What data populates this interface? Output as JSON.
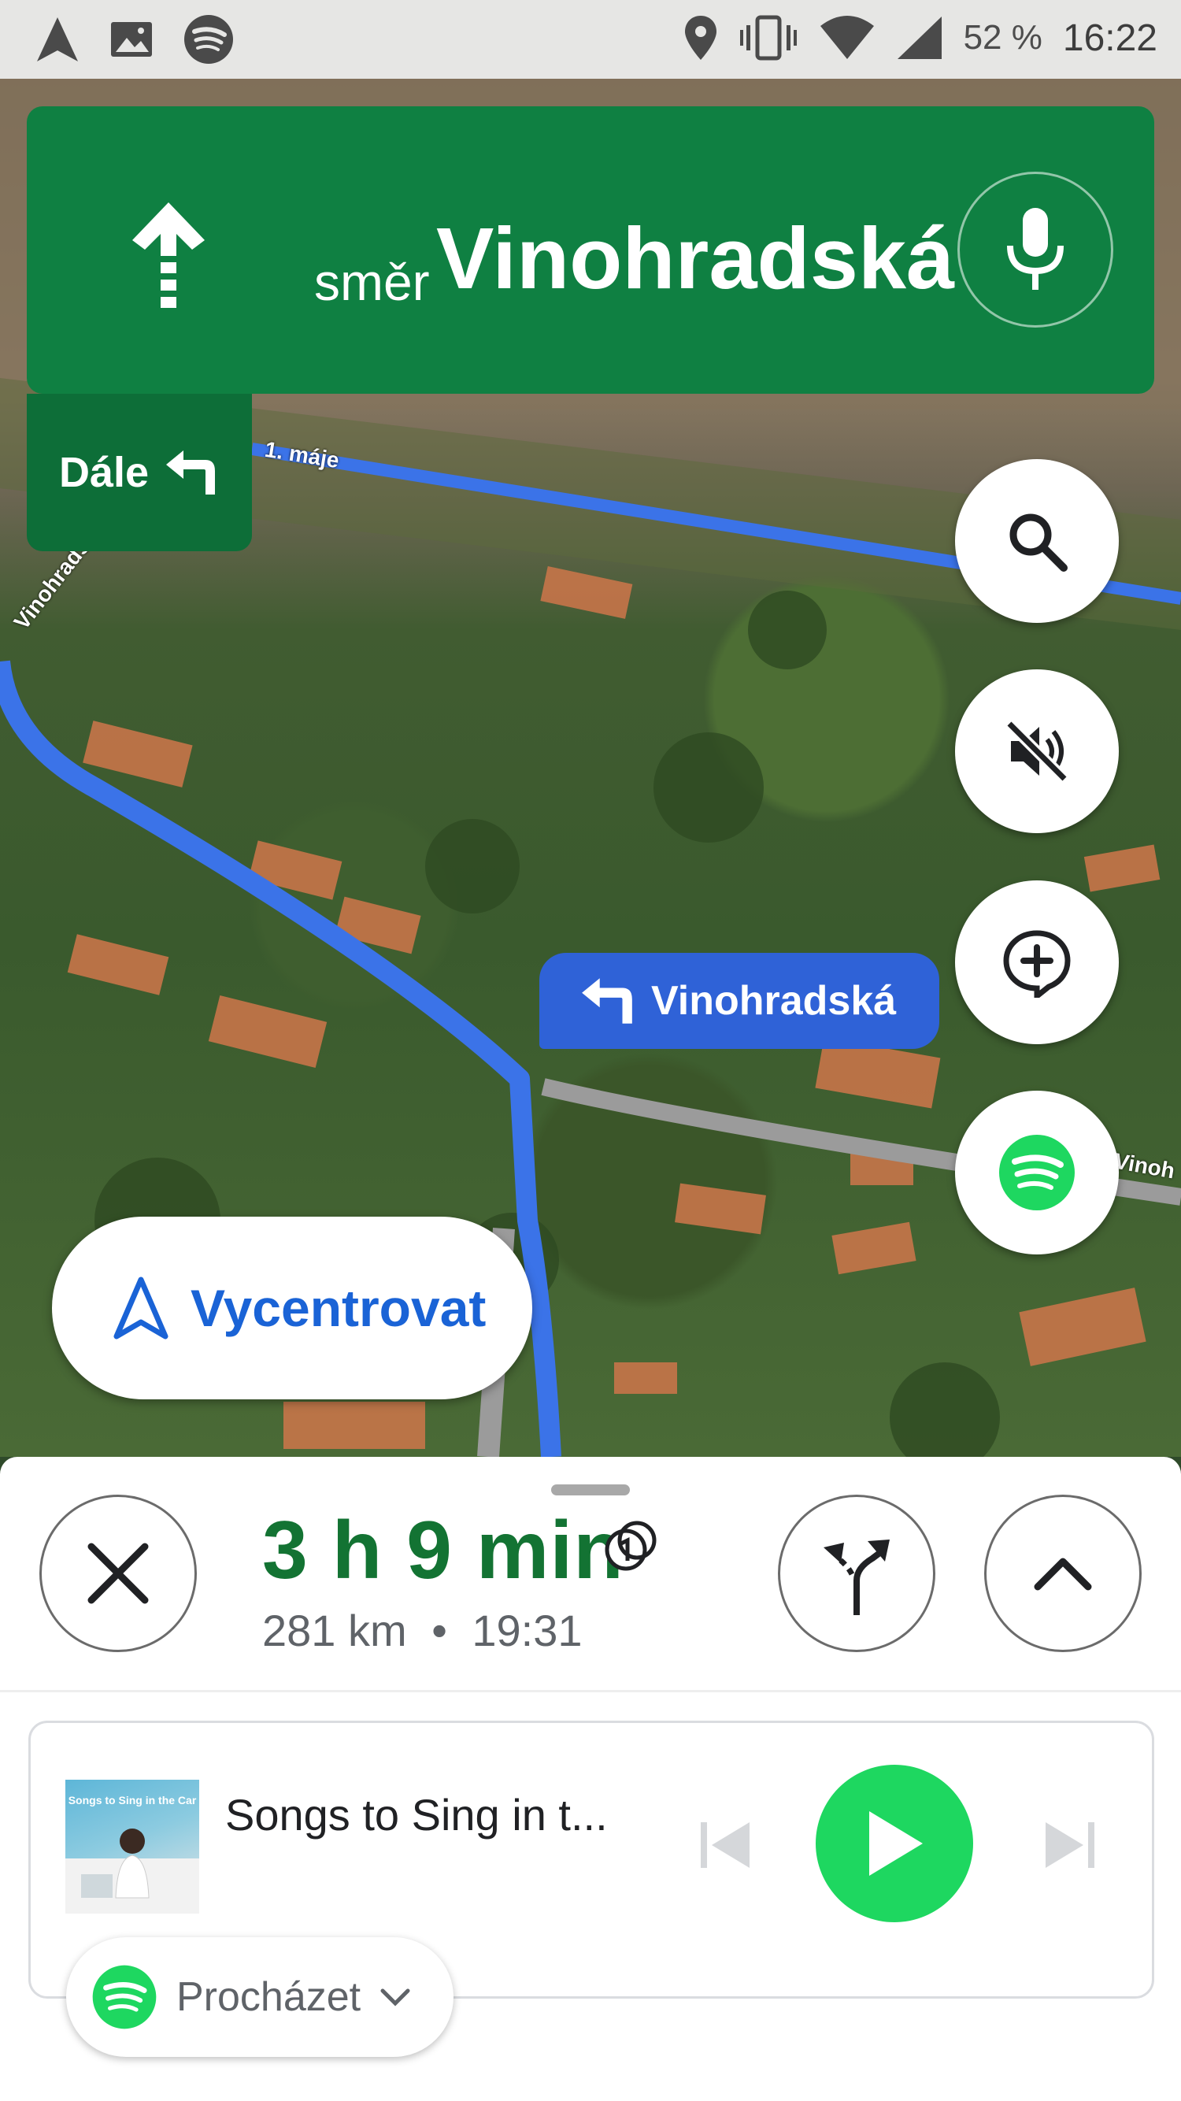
{
  "status_bar": {
    "battery": "52 %",
    "time": "16:22",
    "left_icons": [
      "navigation-icon",
      "image-icon",
      "spotify-icon"
    ],
    "right_icons": [
      "location-icon",
      "vibrate-icon",
      "wifi-icon",
      "signal-icon"
    ]
  },
  "navigation": {
    "direction_prefix": "směr",
    "street": "Vinohradská",
    "next_label": "Dále",
    "maneuver_icon": "straight-arrow-icon",
    "next_icon": "turn-left-icon",
    "voice_icon": "mic-icon"
  },
  "map": {
    "callout_street": "Vinohradská",
    "road_labels": [
      "1. máje",
      "Vinohradsk",
      "Vinoh"
    ],
    "recenter_label": "Vycentrovat",
    "route_color": "#3b73e8",
    "fab_icons": [
      "search-icon",
      "mute-icon",
      "add-report-icon",
      "spotify-icon"
    ]
  },
  "trip": {
    "duration": "3 h 9 min",
    "distance": "281 km",
    "separator": "•",
    "arrival": "19:31",
    "buttons": [
      "close-icon",
      "alternate-routes-icon",
      "expand-icon"
    ]
  },
  "media": {
    "album_art_text": "Songs to Sing in the Car",
    "track_title": "Songs to Sing in t...",
    "browse_label": "Procházet",
    "accent_color": "#1ed760"
  },
  "colors": {
    "banner_green": "#0f8042",
    "eta_green": "#137333",
    "recenter_blue": "#1a63d6"
  }
}
